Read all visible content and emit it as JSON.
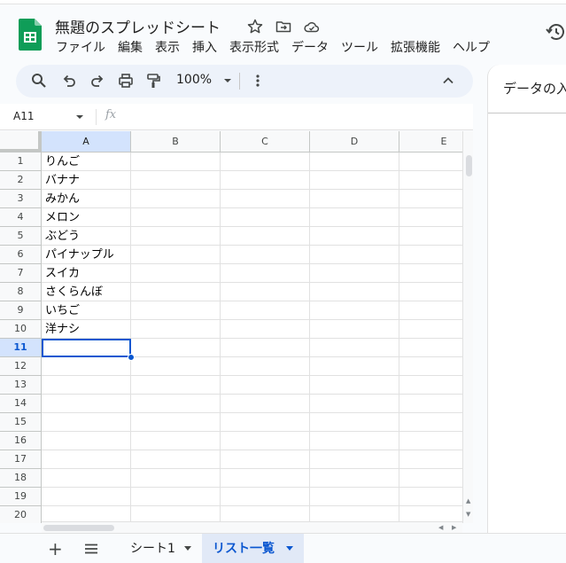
{
  "doc": {
    "title": "無題のスプレッドシート"
  },
  "menu": [
    "ファイル",
    "編集",
    "表示",
    "挿入",
    "表示形式",
    "データ",
    "ツール",
    "拡張機能",
    "ヘルプ"
  ],
  "toolbar": {
    "zoom": "100%"
  },
  "formula_bar": {
    "name_box": "A11",
    "fx": "fx"
  },
  "columns": [
    "A",
    "B",
    "C",
    "D",
    "E"
  ],
  "rows": [
    "1",
    "2",
    "3",
    "4",
    "5",
    "6",
    "7",
    "8",
    "9",
    "10",
    "11",
    "12",
    "13",
    "14",
    "15",
    "16",
    "17",
    "18",
    "19",
    "20"
  ],
  "cells_a": [
    "りんご",
    "バナナ",
    "みかん",
    "メロン",
    "ぶどう",
    "パイナップル",
    "スイカ",
    "さくらんぼ",
    "いちご",
    "洋ナシ"
  ],
  "sheets": {
    "tab1": "シート1",
    "tab2": "リスト一覧"
  },
  "side_panel": {
    "title": "データの入"
  },
  "colors": {
    "accent": "#0b57d0",
    "selected_header": "#d3e3fd",
    "logo_green": "#0f9d58"
  }
}
